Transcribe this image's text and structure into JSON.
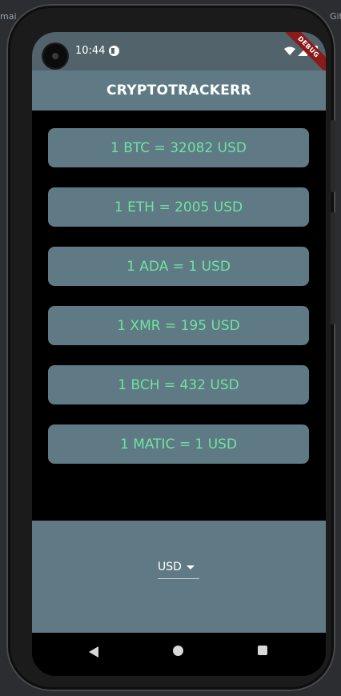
{
  "ide": {
    "left_fragment": "mai",
    "right_fragment": "Git"
  },
  "status_bar": {
    "time": "10:44",
    "debug_label": "DEBUG"
  },
  "app_bar": {
    "title": "CRYPTOTRACKERR"
  },
  "rates": [
    {
      "text": "1 BTC = 32082 USD"
    },
    {
      "text": "1 ETH = 2005 USD"
    },
    {
      "text": "1 ADA = 1 USD"
    },
    {
      "text": "1 XMR = 195 USD"
    },
    {
      "text": "1 BCH = 432 USD"
    },
    {
      "text": "1 MATIC = 1 USD"
    }
  ],
  "currency_picker": {
    "selected": "USD"
  },
  "icons": {
    "status": [
      "app-notification-icon",
      "wifi-icon",
      "signal-icon",
      "battery-icon"
    ],
    "nav": [
      "back-icon",
      "home-icon",
      "recents-icon"
    ]
  },
  "colors": {
    "app_bar": "#5f7a85",
    "status_bar": "#52636b",
    "card_background": "#5f7a85",
    "card_text": "#6fe3a2",
    "screen_background": "#000000"
  }
}
